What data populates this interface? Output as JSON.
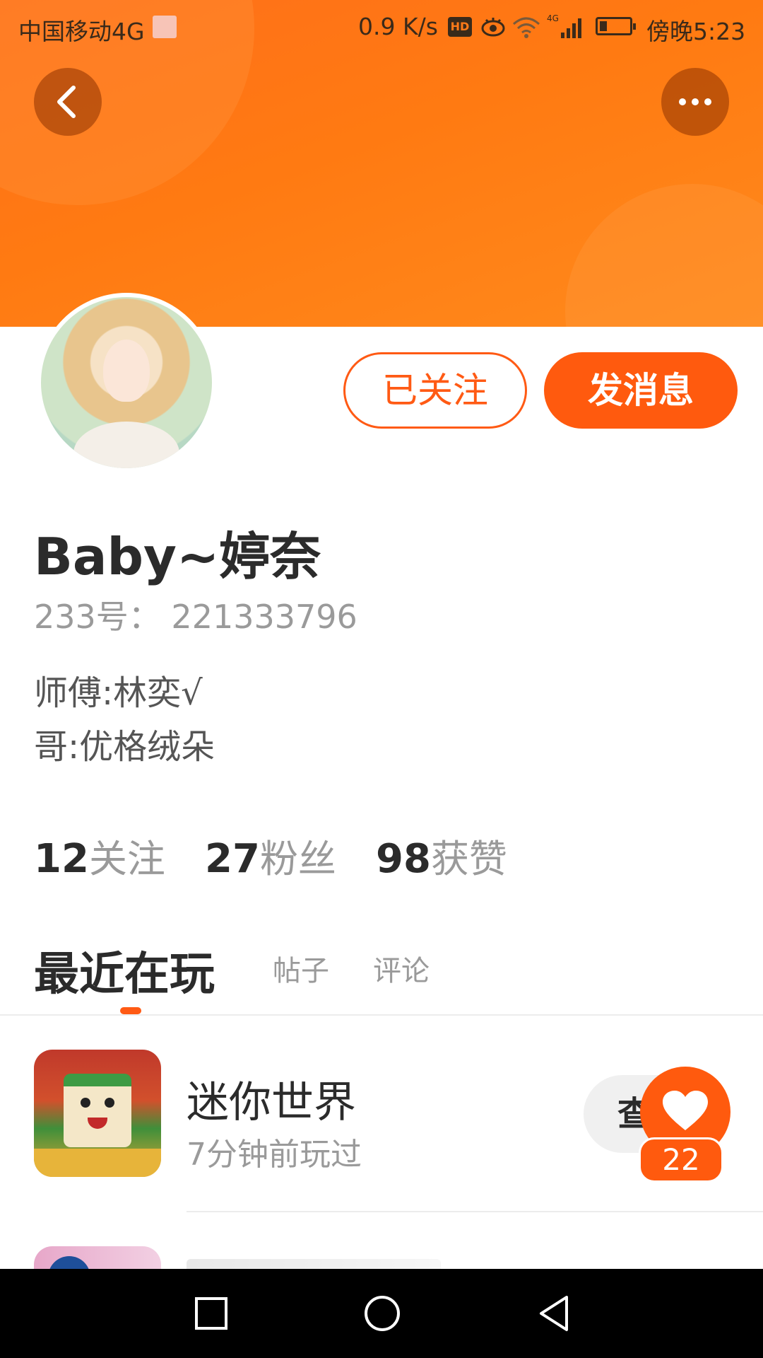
{
  "status_bar": {
    "carrier": "中国移动4G",
    "network_speed": "0.9 K/s",
    "hd_badge": "HD",
    "network_type": "4G",
    "time": "傍晚5:23"
  },
  "header": {
    "back_icon": "chevron-left-icon",
    "more_icon": "more-dots-icon",
    "accent_color": "#ff6f1a"
  },
  "actions": {
    "follow_label": "已关注",
    "message_label": "发消息"
  },
  "profile": {
    "username": "Baby~婷奈",
    "account_id": "233号：  221333796",
    "bio_lines": [
      "师傅:林奕√",
      "哥:优格绒朵"
    ]
  },
  "stats": {
    "following": {
      "count": "12",
      "label": "关注"
    },
    "fans": {
      "count": "27",
      "label": "粉丝"
    },
    "likes": {
      "count": "98",
      "label": "获赞"
    }
  },
  "tabs": {
    "items": [
      "最近在玩",
      "帖子",
      "评论"
    ],
    "active": "最近在玩"
  },
  "games": [
    {
      "name": "迷你世界",
      "last_played": "7分钟前玩过",
      "action_label": "查看"
    }
  ],
  "like_button": {
    "icon": "heart-icon",
    "count": "22"
  },
  "nav": {
    "icons": [
      "square-recents-icon",
      "circle-home-icon",
      "triangle-back-icon"
    ]
  }
}
